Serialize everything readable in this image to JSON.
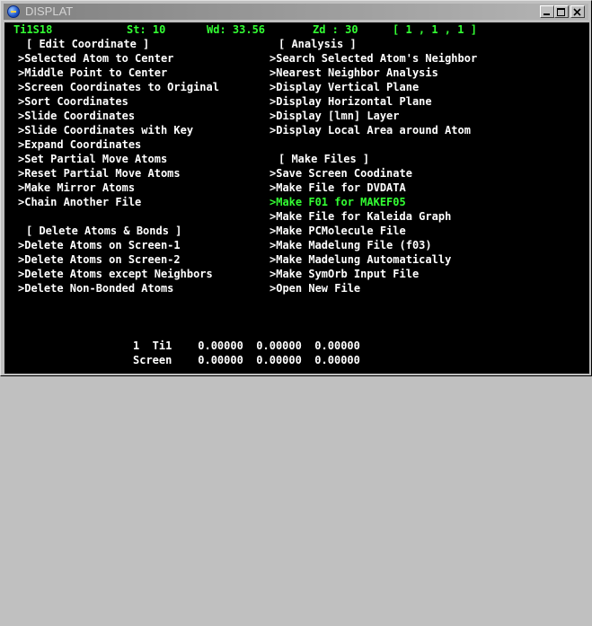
{
  "window": {
    "title": "DISPLAT"
  },
  "status": {
    "name": "Ti1S18",
    "st": "St: 10",
    "wd": "Wd: 33.56",
    "zd": "Zd : 30",
    "idx": "[ 1 , 1 , 1 ]"
  },
  "left": {
    "edit_header": "[ Edit Coordinate ]",
    "edit_items": [
      ">Selected Atom to Center",
      ">Middle Point to Center",
      ">Screen Coordinates to Original",
      ">Sort Coordinates",
      ">Slide Coordinates",
      ">Slide Coordinates with Key",
      ">Expand Coordinates",
      ">Set Partial Move Atoms",
      ">Reset Partial Move Atoms",
      ">Make Mirror Atoms",
      ">Chain Another File"
    ],
    "delete_header": "[ Delete Atoms & Bonds ]",
    "delete_items": [
      ">Delete Atoms on Screen-1",
      ">Delete Atoms on Screen-2",
      ">Delete Atoms except Neighbors",
      ">Delete Non-Bonded Atoms"
    ]
  },
  "right": {
    "analysis_header": "[ Analysis ]",
    "analysis_items": [
      ">Search Selected Atom's Neighbor",
      ">Nearest Neighbor Analysis",
      ">Display Vertical Plane",
      ">Display Horizontal Plane",
      ">Display [lmn] Layer",
      ">Display Local Area around Atom"
    ],
    "files_header": "[ Make Files ]",
    "files_items": [
      ">Save Screen Coodinate",
      ">Make File for DVDATA",
      ">Make F01 for MAKEF05",
      ">Make File for Kaleida Graph",
      ">Make PCMolecule File",
      ">Make Madelung File (f03)",
      ">Make Madelung Automatically",
      ">Make SymOrb Input File",
      ">Open New File"
    ],
    "highlighted_index": 2
  },
  "footer": {
    "row1": "1  Ti1    0.00000  0.00000  0.00000",
    "row2": "Screen    0.00000  0.00000  0.00000"
  },
  "colors": {
    "highlight": "#33ff33",
    "text": "#ffffff",
    "background": "#000000"
  }
}
